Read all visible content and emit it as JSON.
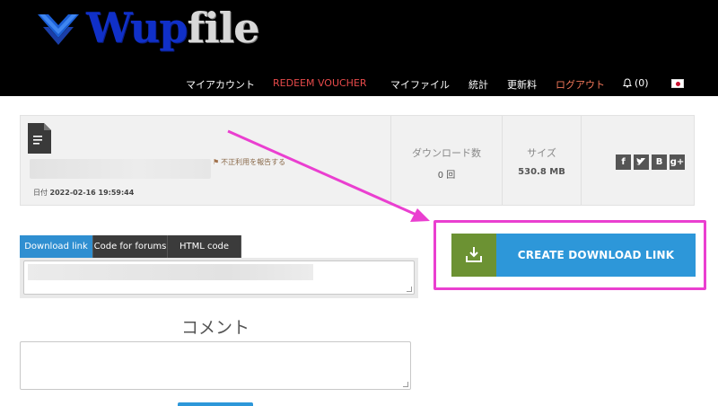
{
  "brand": {
    "logo_part1": "Wup",
    "logo_part2": "file",
    "icon": "wupfile-logo-icon"
  },
  "nav": {
    "items": [
      {
        "label": "マイアカウント"
      },
      {
        "label": "REDEEM VOUCHER"
      },
      {
        "label": "マイファイル"
      },
      {
        "label": "統計"
      },
      {
        "label": "更新料"
      },
      {
        "label": "ログアウト"
      },
      {
        "label": "(0)"
      }
    ],
    "colors": {
      "redeem": "#e64a4a",
      "logout": "#f2775a"
    }
  },
  "file": {
    "icon": "document-icon",
    "report_label": "不正利用を報告する",
    "date_label": "日付",
    "date_value": "2022-02-16 19:59:44"
  },
  "stats": {
    "downloads_label": "ダウンロード数",
    "downloads_value": "0 回",
    "size_label": "サイズ",
    "size_value": "530.8 MB"
  },
  "social": [
    "f",
    "t",
    "B",
    "g+"
  ],
  "cta": {
    "label": "CREATE DOWNLOAD LINK",
    "icon": "download-icon",
    "highlight_color": "#ea3fd0"
  },
  "tabs": [
    {
      "label": "Download link",
      "active": true
    },
    {
      "label": "Code for forums"
    },
    {
      "label": "HTML code"
    }
  ],
  "comment": {
    "title": "コメント"
  }
}
